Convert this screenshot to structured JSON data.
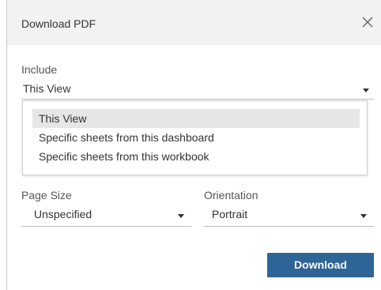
{
  "dialog": {
    "title": "Download PDF",
    "close_icon": "close-icon"
  },
  "include": {
    "label": "Include",
    "value": "This View",
    "options": [
      "This View",
      "Specific sheets from this dashboard",
      "Specific sheets from this workbook"
    ],
    "selected_index": 0
  },
  "page_size": {
    "label": "Page Size",
    "value": "Unspecified"
  },
  "orientation": {
    "label": "Orientation",
    "value": "Portrait"
  },
  "actions": {
    "download_label": "Download"
  },
  "colors": {
    "header_bg": "#f2f2f2",
    "primary_button": "#2f6496",
    "option_selected_bg": "#e6e6e6"
  }
}
